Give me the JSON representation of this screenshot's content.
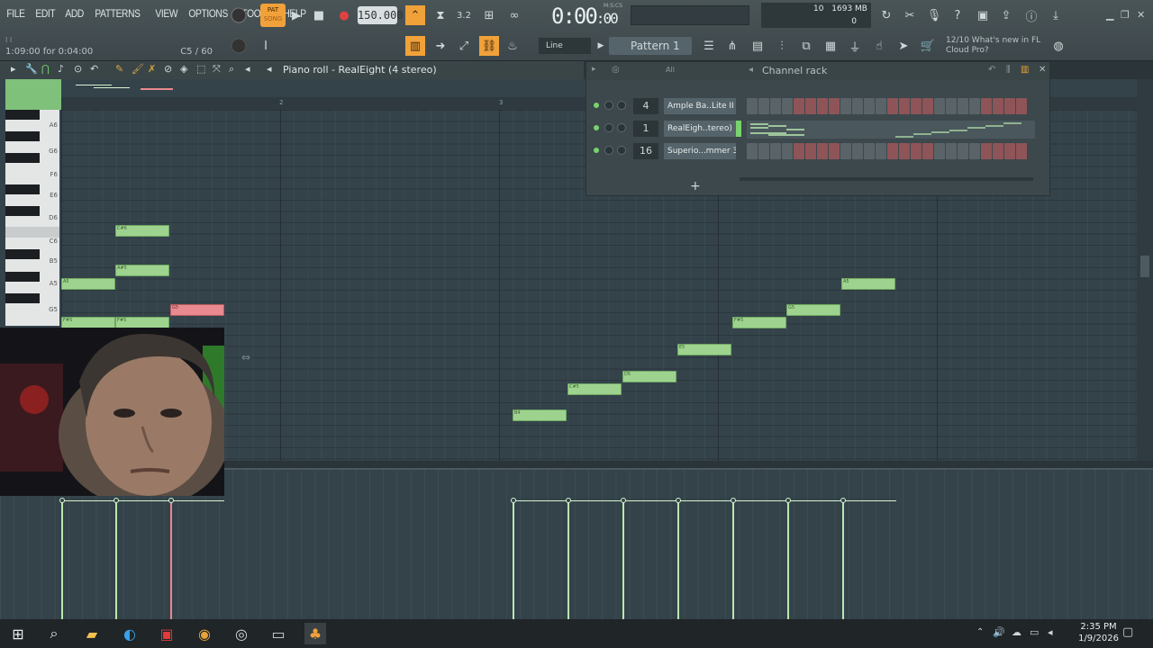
{
  "menu": [
    "FILE",
    "EDIT",
    "ADD",
    "PATTERNS",
    "VIEW",
    "OPTIONS",
    "TOOLS",
    "HELP"
  ],
  "hint": {
    "tiny": "I I",
    "left": "1:09:00 for 0:04:00",
    "right": "C5 / 60"
  },
  "transport": {
    "pat_label": "PAT",
    "song_label": "SONG",
    "tempo": "150.000",
    "time_main": "0:00",
    "time_sub": "00",
    "time_unit": "M:S:CS"
  },
  "performance": {
    "cpu": "10",
    "ram": "1693 MB",
    "poly": "0"
  },
  "pattern_selector": "Pattern 1",
  "snap_mode": "Line",
  "news": {
    "line1": "12/10  What's new in FL",
    "line2": "Cloud Pro?"
  },
  "piano_roll": {
    "title": "Piano roll - RealEight (4 stereo)",
    "ruler": [
      "2",
      "3"
    ],
    "key_labels": [
      "A6",
      "G6",
      "F6",
      "E6",
      "D6",
      "C6",
      "B5",
      "A5",
      "G5"
    ],
    "notes": [
      {
        "label": "C#6"
      },
      {
        "label": "A#5"
      },
      {
        "label": "A#5"
      },
      {
        "label": "A5"
      },
      {
        "label": "G5"
      },
      {
        "label": "F#5"
      },
      {
        "label": "F#5"
      },
      {
        "label": "B4"
      },
      {
        "label": "C#5"
      },
      {
        "label": "D5"
      },
      {
        "label": "E5"
      },
      {
        "label": "F#5"
      },
      {
        "label": "G5"
      },
      {
        "label": "A5"
      }
    ]
  },
  "channel_rack": {
    "title": "Channel rack",
    "filter": "All",
    "channels": [
      {
        "number": "4",
        "name": "Ample Ba..Lite II"
      },
      {
        "number": "1",
        "name": "RealEigh..tereo)"
      },
      {
        "number": "16",
        "name": "Superio...mmer 3"
      }
    ],
    "add_label": "+"
  },
  "taskbar": {
    "time": "2:35 PM",
    "date": "1/9/2026"
  },
  "colors": {
    "note": "#9ed38f",
    "note_selected": "#e88a8f",
    "accent": "#f1a13a"
  }
}
